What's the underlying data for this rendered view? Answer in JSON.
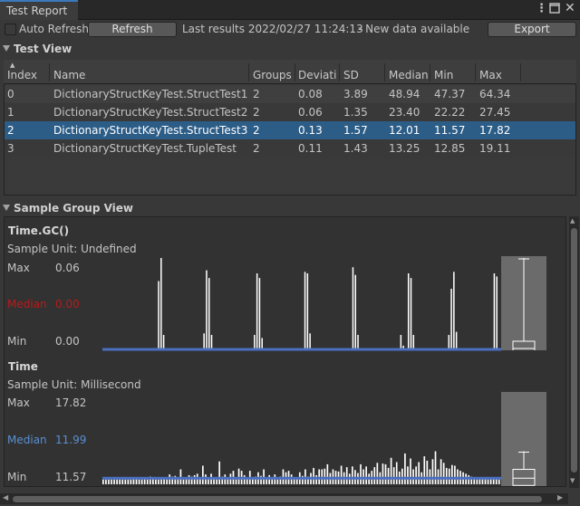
{
  "window": {
    "tab_label": "Test Report"
  },
  "toolbar": {
    "auto_refresh_label": "Auto Refresh",
    "auto_refresh_checked": false,
    "refresh_label": "Refresh",
    "last_results": "Last results 2022/02/27 11:24:13",
    "status": "- New data available",
    "export_label": "Export"
  },
  "test_view": {
    "header": "Test View",
    "columns": [
      "Index",
      "Name",
      "Groups",
      "Deviati",
      "SD",
      "Median",
      "Min",
      "Max"
    ],
    "rows": [
      [
        "0",
        "DictionaryStructKeyTest.StructTest1",
        "2",
        "0.08",
        "3.89",
        "48.94",
        "47.37",
        "64.34"
      ],
      [
        "1",
        "DictionaryStructKeyTest.StructTest2",
        "2",
        "0.06",
        "1.35",
        "23.40",
        "22.22",
        "27.45"
      ],
      [
        "2",
        "DictionaryStructKeyTest.StructTest3",
        "2",
        "0.13",
        "1.57",
        "12.01",
        "11.57",
        "17.82"
      ],
      [
        "3",
        "DictionaryStructKeyTest.TupleTest",
        "2",
        "0.11",
        "1.43",
        "13.25",
        "12.85",
        "19.11"
      ]
    ],
    "selected_index": 2
  },
  "sample_group_view": {
    "header": "Sample Group View",
    "groups": [
      {
        "title": "Time.GC()",
        "unit": "Sample Unit: Undefined",
        "max_label": "Max",
        "max": "0.06",
        "median_label": "Median",
        "median": "0.00",
        "min_label": "Min",
        "min": "0.00",
        "median_color": "#b81a1a",
        "line_color": "#4a6fc0"
      },
      {
        "title": "Time",
        "unit": "Sample Unit: Millisecond",
        "max_label": "Max",
        "max": "17.82",
        "median_label": "Median",
        "median": "11.99",
        "min_label": "Min",
        "min": "11.57",
        "median_color": "#5a8fd0",
        "line_color": "#4a6fc0"
      }
    ]
  },
  "chart_data": [
    {
      "type": "bar",
      "ylim": [
        0,
        0.06
      ],
      "median": 0.0,
      "values": [
        0,
        0,
        0,
        0,
        0,
        0,
        0,
        0,
        0,
        0,
        0,
        0,
        0,
        0,
        0,
        0,
        0,
        0,
        0,
        0,
        0,
        0,
        0.045,
        0.06,
        0.01,
        0,
        0,
        0,
        0,
        0,
        0,
        0,
        0,
        0,
        0,
        0,
        0,
        0,
        0,
        0,
        0.011,
        0.052,
        0.047,
        0.01,
        0,
        0,
        0,
        0,
        0,
        0,
        0,
        0,
        0,
        0,
        0,
        0,
        0,
        0,
        0,
        0,
        0.01,
        0.05,
        0.047,
        0.008,
        0,
        0,
        0,
        0,
        0,
        0,
        0,
        0,
        0,
        0,
        0,
        0,
        0,
        0,
        0,
        0,
        0.051,
        0.05,
        0.011,
        0,
        0,
        0,
        0,
        0,
        0,
        0,
        0,
        0,
        0,
        0,
        0,
        0,
        0,
        0,
        0,
        0.054,
        0.049,
        0.01,
        0,
        0,
        0,
        0,
        0,
        0,
        0,
        0,
        0,
        0,
        0,
        0,
        0,
        0,
        0,
        0,
        0.01,
        0.003,
        0,
        0.05,
        0.047,
        0.01,
        0,
        0,
        0,
        0,
        0,
        0,
        0,
        0,
        0,
        0,
        0,
        0,
        0,
        0.01,
        0.04,
        0.051,
        0.012,
        0,
        0,
        0,
        0,
        0,
        0,
        0,
        0,
        0,
        0,
        0,
        0,
        0,
        0,
        0.05,
        0.048,
        0
      ]
    },
    {
      "type": "bar",
      "ylim": [
        11.57,
        17.82
      ],
      "median": 11.99,
      "values": [
        11.9,
        11.9,
        11.9,
        11.9,
        11.9,
        11.9,
        11.9,
        11.9,
        11.9,
        11.9,
        11.9,
        12.0,
        12.05,
        11.9,
        11.9,
        12.0,
        11.9,
        12.1,
        12.02,
        11.9,
        11.9,
        12.0,
        12.05,
        11.9,
        12.25,
        12.1,
        12.15,
        12.0,
        12.6,
        11.9,
        11.95,
        12.2,
        12.1,
        12.2,
        12.3,
        12.05,
        12.85,
        12.25,
        12.05,
        12.3,
        12.0,
        11.9,
        13.15,
        12.1,
        12.25,
        12.0,
        12.3,
        12.5,
        11.9,
        12.65,
        12.5,
        12.2,
        12.0,
        12.5,
        12.05,
        12.1,
        12.4,
        12.15,
        12.6,
        11.95,
        12.2,
        12.0,
        12.25,
        11.9,
        12.1,
        12.6,
        12.4,
        12.5,
        12.25,
        12.0,
        12.05,
        12.4,
        12.15,
        12.6,
        12.1,
        12.35,
        12.7,
        12.2,
        12.6,
        12.6,
        12.65,
        12.95,
        12.35,
        12.6,
        12.5,
        12.45,
        12.85,
        12.4,
        12.75,
        12.3,
        12.8,
        12.55,
        12.35,
        12.95,
        12.6,
        12.8,
        12.3,
        12.5,
        12.75,
        13.05,
        12.4,
        13.0,
        12.95,
        12.7,
        13.4,
        12.75,
        13.1,
        12.45,
        12.65,
        13.7,
        12.8,
        13.35,
        12.6,
        12.8,
        13.1,
        12.4,
        13.5,
        13.2,
        12.6,
        13.3,
        13.85,
        12.6,
        13.3,
        13.05,
        12.7,
        12.65,
        12.9,
        12.85,
        12.6,
        12.5,
        12.4,
        12.3,
        12.2,
        12.1,
        12.0,
        11.9,
        12.05,
        12.0,
        11.95,
        11.9,
        12.0,
        12.05,
        11.95,
        11.9
      ]
    }
  ]
}
